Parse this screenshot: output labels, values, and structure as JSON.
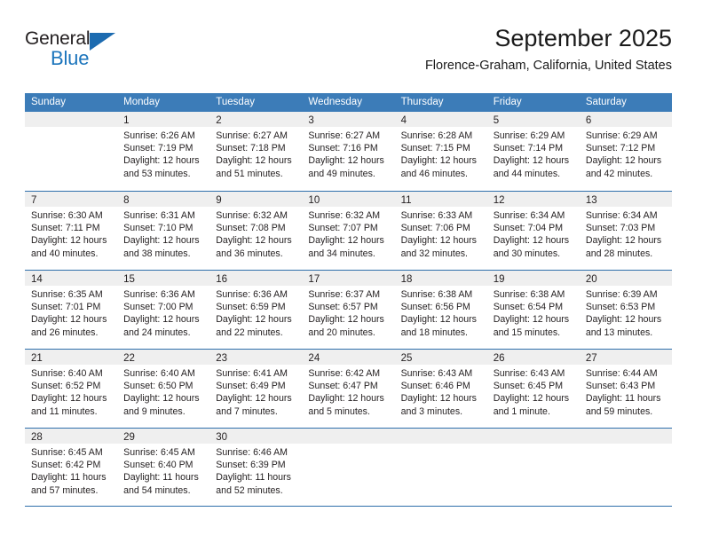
{
  "logo": {
    "word_one": "General",
    "word_two": "Blue",
    "triangle_color": "#1c6bb0",
    "blue_color": "#1c75bc"
  },
  "header": {
    "title": "September 2025",
    "subtitle": "Florence-Graham, California, United States"
  },
  "theme": {
    "header_blue": "#3c7cb8",
    "rule_blue": "#2f6fab",
    "daynum_band": "#efefef",
    "text": "#231f20"
  },
  "weekdays": [
    "Sunday",
    "Monday",
    "Tuesday",
    "Wednesday",
    "Thursday",
    "Friday",
    "Saturday"
  ],
  "weeks": [
    [
      {
        "day": "",
        "lines": []
      },
      {
        "day": "1",
        "lines": [
          "Sunrise: 6:26 AM",
          "Sunset: 7:19 PM",
          "Daylight: 12 hours",
          "and 53 minutes."
        ]
      },
      {
        "day": "2",
        "lines": [
          "Sunrise: 6:27 AM",
          "Sunset: 7:18 PM",
          "Daylight: 12 hours",
          "and 51 minutes."
        ]
      },
      {
        "day": "3",
        "lines": [
          "Sunrise: 6:27 AM",
          "Sunset: 7:16 PM",
          "Daylight: 12 hours",
          "and 49 minutes."
        ]
      },
      {
        "day": "4",
        "lines": [
          "Sunrise: 6:28 AM",
          "Sunset: 7:15 PM",
          "Daylight: 12 hours",
          "and 46 minutes."
        ]
      },
      {
        "day": "5",
        "lines": [
          "Sunrise: 6:29 AM",
          "Sunset: 7:14 PM",
          "Daylight: 12 hours",
          "and 44 minutes."
        ]
      },
      {
        "day": "6",
        "lines": [
          "Sunrise: 6:29 AM",
          "Sunset: 7:12 PM",
          "Daylight: 12 hours",
          "and 42 minutes."
        ]
      }
    ],
    [
      {
        "day": "7",
        "lines": [
          "Sunrise: 6:30 AM",
          "Sunset: 7:11 PM",
          "Daylight: 12 hours",
          "and 40 minutes."
        ]
      },
      {
        "day": "8",
        "lines": [
          "Sunrise: 6:31 AM",
          "Sunset: 7:10 PM",
          "Daylight: 12 hours",
          "and 38 minutes."
        ]
      },
      {
        "day": "9",
        "lines": [
          "Sunrise: 6:32 AM",
          "Sunset: 7:08 PM",
          "Daylight: 12 hours",
          "and 36 minutes."
        ]
      },
      {
        "day": "10",
        "lines": [
          "Sunrise: 6:32 AM",
          "Sunset: 7:07 PM",
          "Daylight: 12 hours",
          "and 34 minutes."
        ]
      },
      {
        "day": "11",
        "lines": [
          "Sunrise: 6:33 AM",
          "Sunset: 7:06 PM",
          "Daylight: 12 hours",
          "and 32 minutes."
        ]
      },
      {
        "day": "12",
        "lines": [
          "Sunrise: 6:34 AM",
          "Sunset: 7:04 PM",
          "Daylight: 12 hours",
          "and 30 minutes."
        ]
      },
      {
        "day": "13",
        "lines": [
          "Sunrise: 6:34 AM",
          "Sunset: 7:03 PM",
          "Daylight: 12 hours",
          "and 28 minutes."
        ]
      }
    ],
    [
      {
        "day": "14",
        "lines": [
          "Sunrise: 6:35 AM",
          "Sunset: 7:01 PM",
          "Daylight: 12 hours",
          "and 26 minutes."
        ]
      },
      {
        "day": "15",
        "lines": [
          "Sunrise: 6:36 AM",
          "Sunset: 7:00 PM",
          "Daylight: 12 hours",
          "and 24 minutes."
        ]
      },
      {
        "day": "16",
        "lines": [
          "Sunrise: 6:36 AM",
          "Sunset: 6:59 PM",
          "Daylight: 12 hours",
          "and 22 minutes."
        ]
      },
      {
        "day": "17",
        "lines": [
          "Sunrise: 6:37 AM",
          "Sunset: 6:57 PM",
          "Daylight: 12 hours",
          "and 20 minutes."
        ]
      },
      {
        "day": "18",
        "lines": [
          "Sunrise: 6:38 AM",
          "Sunset: 6:56 PM",
          "Daylight: 12 hours",
          "and 18 minutes."
        ]
      },
      {
        "day": "19",
        "lines": [
          "Sunrise: 6:38 AM",
          "Sunset: 6:54 PM",
          "Daylight: 12 hours",
          "and 15 minutes."
        ]
      },
      {
        "day": "20",
        "lines": [
          "Sunrise: 6:39 AM",
          "Sunset: 6:53 PM",
          "Daylight: 12 hours",
          "and 13 minutes."
        ]
      }
    ],
    [
      {
        "day": "21",
        "lines": [
          "Sunrise: 6:40 AM",
          "Sunset: 6:52 PM",
          "Daylight: 12 hours",
          "and 11 minutes."
        ]
      },
      {
        "day": "22",
        "lines": [
          "Sunrise: 6:40 AM",
          "Sunset: 6:50 PM",
          "Daylight: 12 hours",
          "and 9 minutes."
        ]
      },
      {
        "day": "23",
        "lines": [
          "Sunrise: 6:41 AM",
          "Sunset: 6:49 PM",
          "Daylight: 12 hours",
          "and 7 minutes."
        ]
      },
      {
        "day": "24",
        "lines": [
          "Sunrise: 6:42 AM",
          "Sunset: 6:47 PM",
          "Daylight: 12 hours",
          "and 5 minutes."
        ]
      },
      {
        "day": "25",
        "lines": [
          "Sunrise: 6:43 AM",
          "Sunset: 6:46 PM",
          "Daylight: 12 hours",
          "and 3 minutes."
        ]
      },
      {
        "day": "26",
        "lines": [
          "Sunrise: 6:43 AM",
          "Sunset: 6:45 PM",
          "Daylight: 12 hours",
          "and 1 minute."
        ]
      },
      {
        "day": "27",
        "lines": [
          "Sunrise: 6:44 AM",
          "Sunset: 6:43 PM",
          "Daylight: 11 hours",
          "and 59 minutes."
        ]
      }
    ],
    [
      {
        "day": "28",
        "lines": [
          "Sunrise: 6:45 AM",
          "Sunset: 6:42 PM",
          "Daylight: 11 hours",
          "and 57 minutes."
        ]
      },
      {
        "day": "29",
        "lines": [
          "Sunrise: 6:45 AM",
          "Sunset: 6:40 PM",
          "Daylight: 11 hours",
          "and 54 minutes."
        ]
      },
      {
        "day": "30",
        "lines": [
          "Sunrise: 6:46 AM",
          "Sunset: 6:39 PM",
          "Daylight: 11 hours",
          "and 52 minutes."
        ]
      },
      {
        "day": "",
        "lines": []
      },
      {
        "day": "",
        "lines": []
      },
      {
        "day": "",
        "lines": []
      },
      {
        "day": "",
        "lines": []
      }
    ]
  ]
}
